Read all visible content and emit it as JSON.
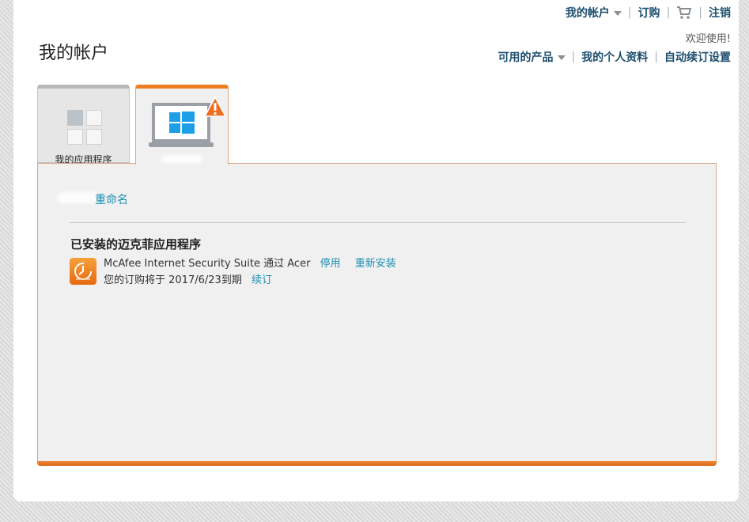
{
  "header": {
    "account_menu": "我的帐户",
    "subscriptions": "订购",
    "logout": "注销",
    "welcome": "欢迎使用!",
    "available_products": "可用的产品",
    "my_profile": "我的个人资料",
    "auto_renew_settings": "自动续订设置"
  },
  "page": {
    "title": "我的帐户"
  },
  "tabs": {
    "apps_label": "我的应用程序"
  },
  "device": {
    "rename_link": "重命名",
    "installed_title": "已安装的迈克菲应用程序",
    "app_name": "McAfee Internet Security Suite",
    "via_text": "通过",
    "vendor": "Acer",
    "disable_label": "停用",
    "reinstall_label": "重新安装",
    "expiry_prefix": "您的订购将于",
    "expiry_date": "2017/6/23",
    "expiry_suffix": "到期",
    "renew_label": "续订"
  },
  "colors": {
    "nav_text": "#1e4f6e",
    "link_blue": "#1f8fb3",
    "accent_orange": "#ef7d22",
    "windows_blue": "#1f9ee8",
    "warning_orange": "#f26b1d"
  }
}
